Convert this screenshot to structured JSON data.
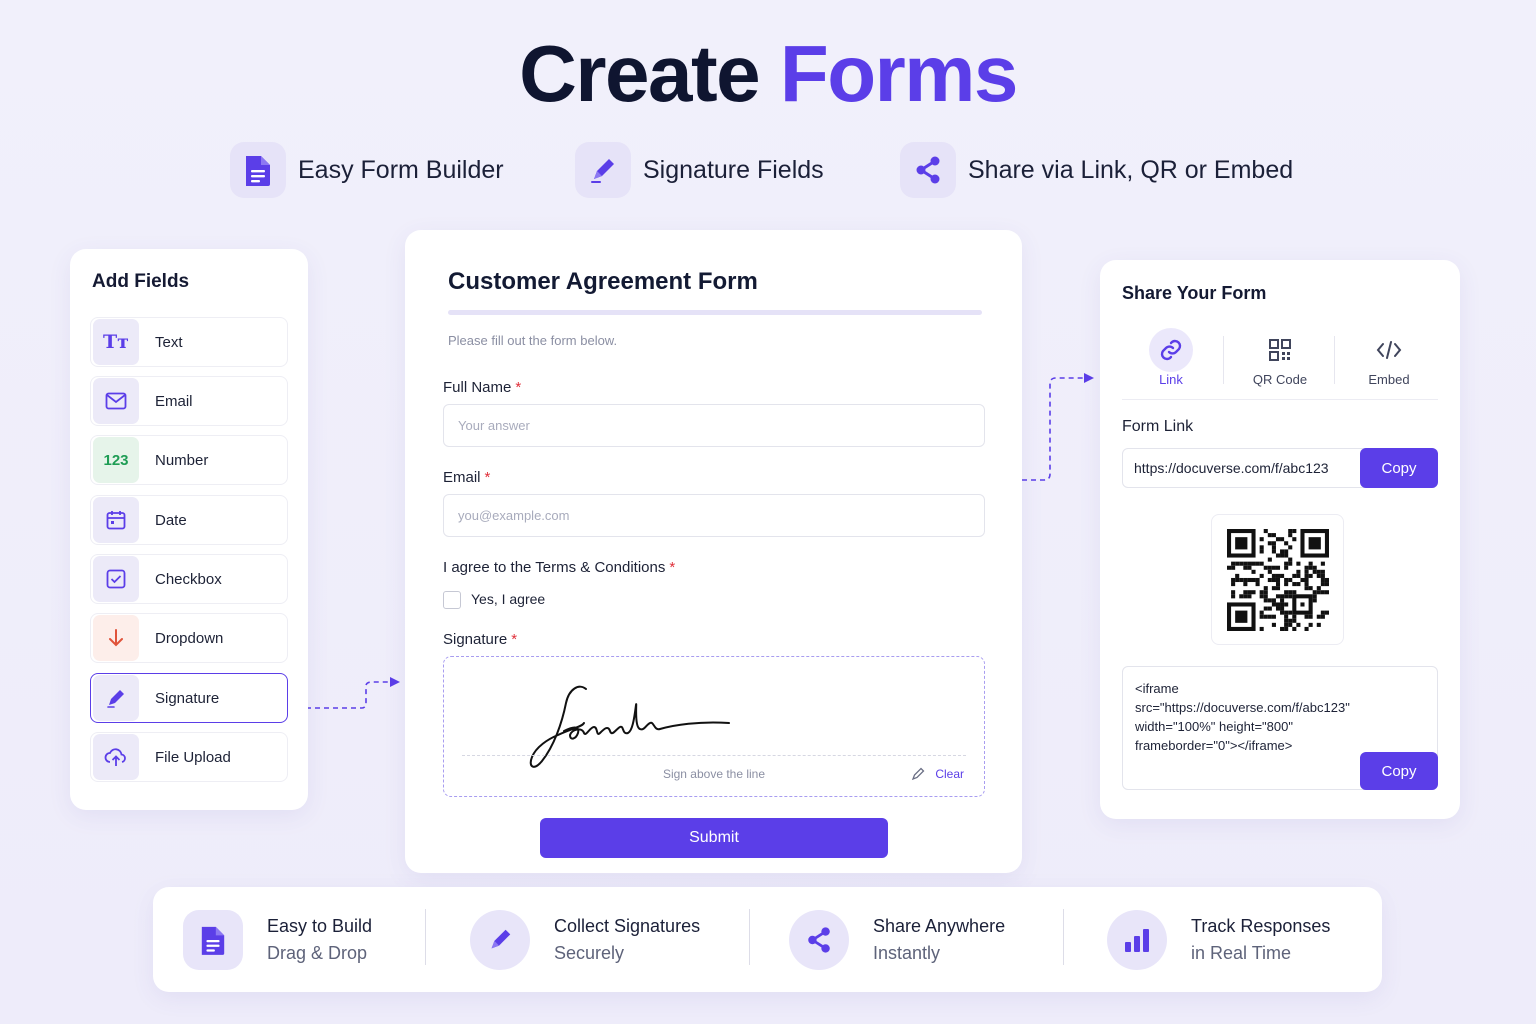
{
  "header": {
    "title_part1": "Create",
    "title_part2": "Forms"
  },
  "features": [
    {
      "label": "Easy Form Builder",
      "icon": "document-icon"
    },
    {
      "label": "Signature Fields",
      "icon": "pen-icon"
    },
    {
      "label": "Share via Link, QR or Embed",
      "icon": "share-icon"
    }
  ],
  "add_fields": {
    "title": "Add Fields",
    "items": [
      {
        "label": "Text",
        "icon": "text-icon",
        "icon_text": "Tт"
      },
      {
        "label": "Email",
        "icon": "envelope-icon"
      },
      {
        "label": "Number",
        "icon": "number-icon",
        "icon_text": "123"
      },
      {
        "label": "Date",
        "icon": "calendar-icon"
      },
      {
        "label": "Checkbox",
        "icon": "checkbox-icon"
      },
      {
        "label": "Dropdown",
        "icon": "arrow-down-icon"
      },
      {
        "label": "Signature",
        "icon": "pen-icon",
        "selected": true
      },
      {
        "label": "File Upload",
        "icon": "cloud-upload-icon"
      }
    ]
  },
  "form": {
    "title": "Customer Agreement Form",
    "subtitle": "Please fill out the form below.",
    "full_name_label": "Full Name",
    "full_name_placeholder": "Your answer",
    "email_label": "Email",
    "email_placeholder": "you@example.com",
    "terms_label": "I agree to the Terms & Conditions",
    "terms_checkbox_label": "Yes, I agree",
    "signature_label": "Signature",
    "signature_hint": "Sign above the line",
    "clear_label": "Clear",
    "required_mark": "*",
    "submit_label": "Submit"
  },
  "share": {
    "title": "Share Your Form",
    "tabs": [
      {
        "label": "Link",
        "icon": "link-icon",
        "active": true
      },
      {
        "label": "QR Code",
        "icon": "qr-code-icon"
      },
      {
        "label": "Embed",
        "icon": "code-icon"
      }
    ],
    "form_link_label": "Form Link",
    "form_link_value": "https://docuverse.com/f/abc123",
    "copy_label": "Copy",
    "embed_code": "<iframe\nsrc=\"https://docuverse.com/f/abc123\"\nwidth=\"100%\" height=\"800\"\nframeborder=\"0\"></iframe>",
    "embed_copy_label": "Copy"
  },
  "bottom_features": [
    {
      "line1": "Easy to Build",
      "line2": "Drag & Drop",
      "icon": "document-icon"
    },
    {
      "line1": "Collect Signatures",
      "line2": "Securely",
      "icon": "pen-icon"
    },
    {
      "line1": "Share Anywhere",
      "line2": "Instantly",
      "icon": "share-icon"
    },
    {
      "line1": "Track Responses",
      "line2": "in Real Time",
      "icon": "bar-chart-icon"
    }
  ],
  "colors": {
    "accent": "#5b3ee8",
    "title": "#0f1530",
    "required": "#e0303a",
    "number_icon": "#1f9d55",
    "dropdown_icon": "#e0533a"
  }
}
